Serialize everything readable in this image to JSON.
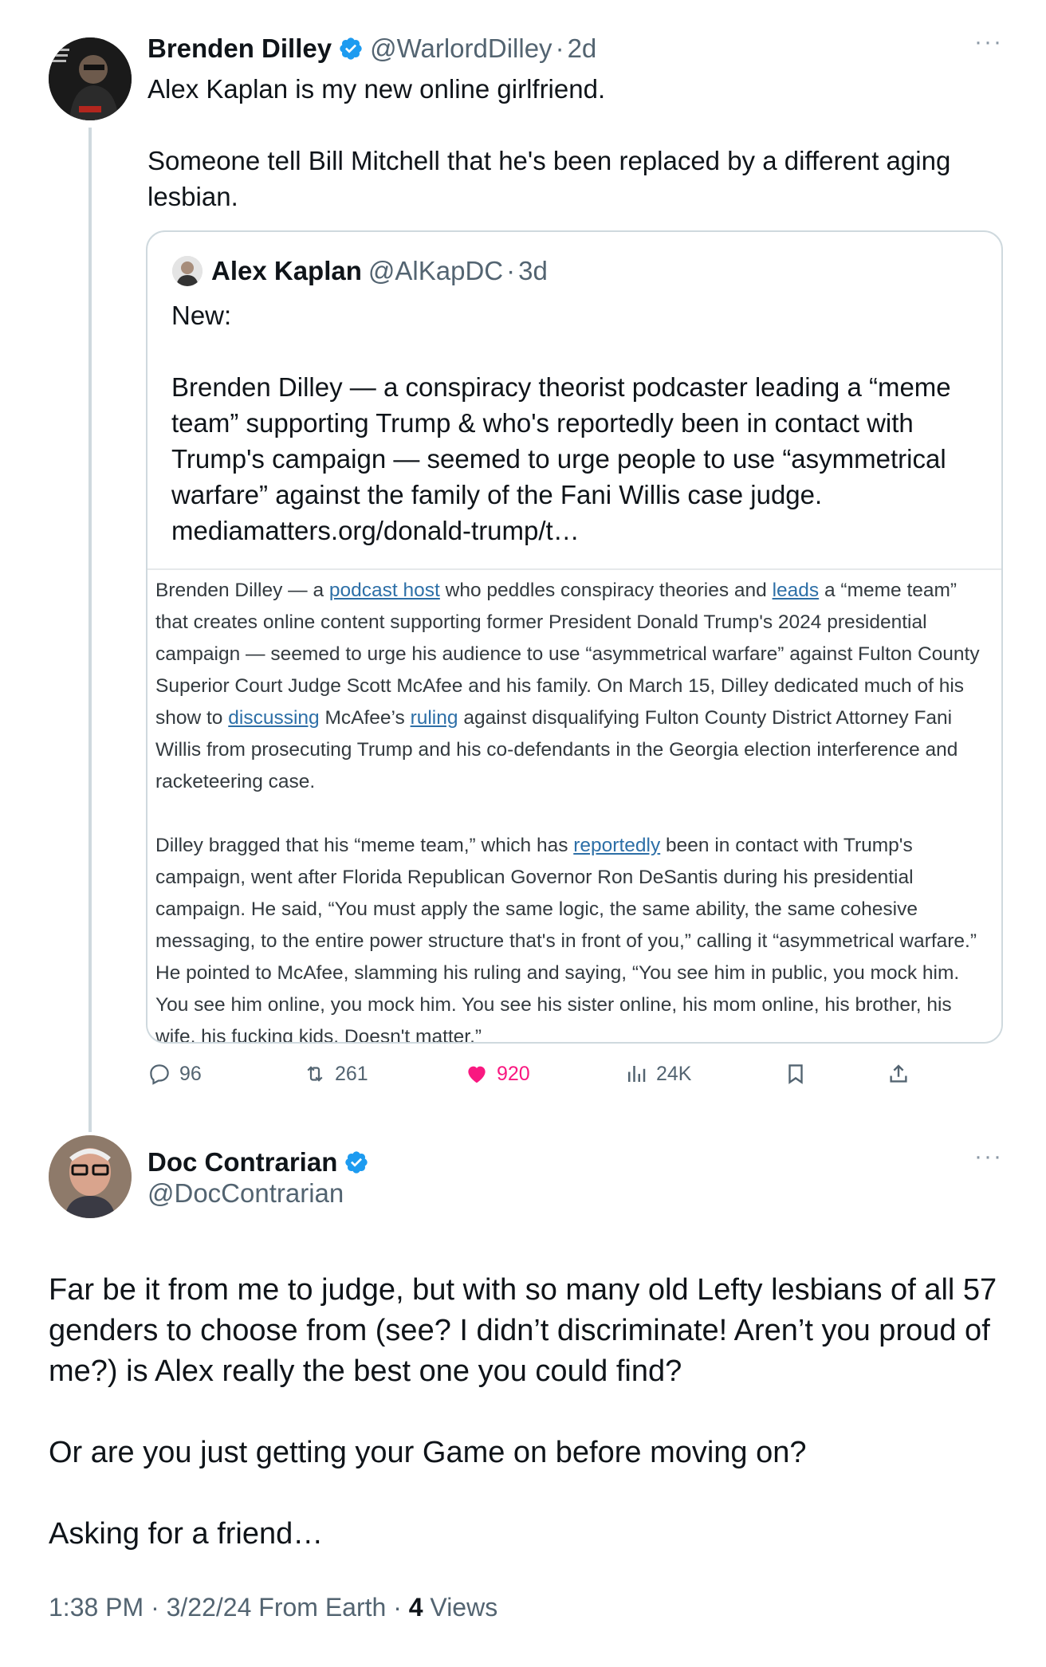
{
  "parent_tweet": {
    "display_name": "Brenden Dilley",
    "handle": "@WarlordDilley",
    "separator": "·",
    "time_ago": "2d",
    "text_line_1": "Alex Kaplan is my new online girlfriend.",
    "text_line_2": "Someone tell Bill Mitchell that he's been replaced by a different aging lesbian.",
    "quote": {
      "display_name": "Alex Kaplan",
      "handle": "@AlKapDC",
      "separator": "·",
      "time_ago": "3d",
      "text_line_1": "New:",
      "text_line_2": "Brenden Dilley — a conspiracy theorist podcaster leading a “meme team” supporting Trump & who's reportedly been in contact with Trump's campaign — seemed to urge people to use “asymmetrical warfare” against the family of the Fani Willis case judge.",
      "link": "mediamatters.org/donald-trump/t…",
      "article": {
        "p1_a": "Brenden Dilley — a ",
        "p1_link1": "podcast host",
        "p1_b": " who peddles conspiracy theories and ",
        "p1_link2": "leads",
        "p1_c": " a “meme team” that creates online content supporting former President Donald Trump's 2024 presidential campaign — seemed to urge his audience to use “asymmetrical warfare” against Fulton County Superior Court Judge Scott McAfee and his family. On March 15, Dilley dedicated much of his show to ",
        "p1_link3": "discussing",
        "p1_d": " McAfee’s ",
        "p1_link4": "ruling",
        "p1_e": " against disqualifying Fulton County District Attorney Fani Willis from prosecuting Trump and his co-defendants in the Georgia election interference and racketeering case.",
        "p2_a": "Dilley bragged that his “meme team,” which has ",
        "p2_link1": "reportedly",
        "p2_b": " been in contact with Trump's campaign, went after Florida Republican Governor Ron DeSantis during his presidential campaign. He said, “You must apply the same logic, the same ability, the same cohesive messaging, to the entire power structure that's in front of you,” calling it “asymmetrical warfare.” He pointed to McAfee, slamming his ruling and saying, “You see him in public, you mock him. You see him online, you mock him. You see his sister online, his mom online, his brother, his wife, his fucking kids. Doesn't matter.”"
      }
    },
    "actions": {
      "replies": "96",
      "reposts": "261",
      "likes": "920",
      "views": "24K"
    }
  },
  "reply_tweet": {
    "display_name": "Doc Contrarian",
    "handle": "@DocContrarian",
    "text_line_1": "Far be it from me to judge, but with so many old Lefty lesbians of all 57 genders to choose from (see? I didn’t discriminate! Aren’t you proud of me?) is Alex really the best one you could find?",
    "text_line_2": "Or are you just getting your Game on before moving on?",
    "text_line_3": "Asking for a friend…",
    "footer_time": "1:38 PM · 3/22/24 From Earth · ",
    "footer_views_count": "4",
    "footer_views_label": " Views"
  },
  "more_icon": "···",
  "colors": {
    "verified": "#1d9bf0",
    "like": "#f91880",
    "muted": "#536471",
    "link": "#2d6fa7",
    "border": "#cfd9de"
  }
}
